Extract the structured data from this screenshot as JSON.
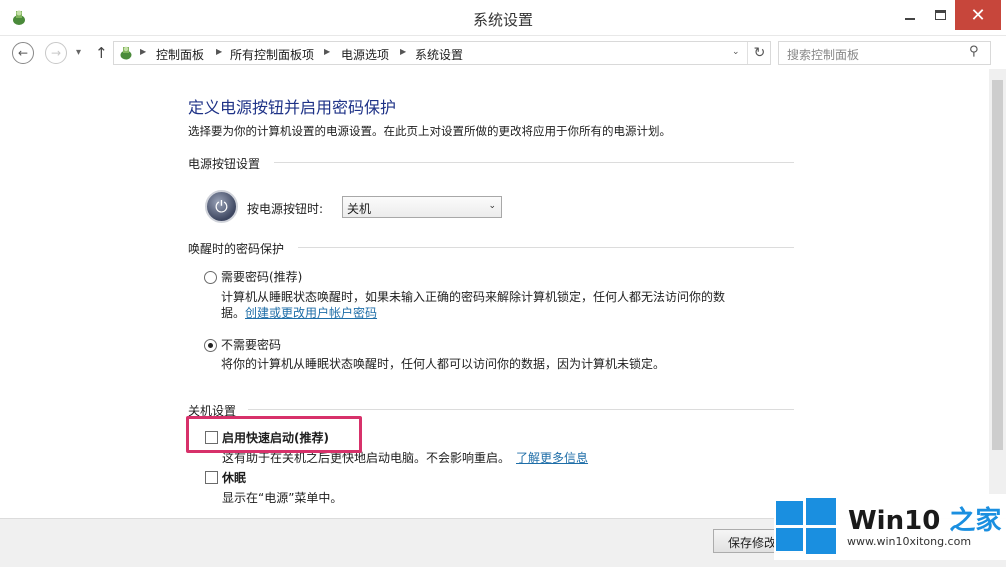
{
  "window": {
    "title": "系统设置",
    "close_glyph": "✕"
  },
  "nav": {
    "back_glyph": "←",
    "forward_glyph": "→",
    "recent_glyph": "▾",
    "up_glyph": "↑",
    "breadcrumbs": [
      "控制面板",
      "所有控制面板项",
      "电源选项",
      "系统设置"
    ],
    "separator_glyph": "▶",
    "dropdown_glyph": "⌄",
    "refresh_glyph": "↻",
    "search_placeholder": "搜索控制面板",
    "search_glyph": "⚲"
  },
  "page": {
    "heading": "定义电源按钮并启用密码保护",
    "description": "选择要为你的计算机设置的电源设置。在此页上对设置所做的更改将应用于你所有的电源计划。"
  },
  "power_button": {
    "section_title": "电源按钮设置",
    "icon_glyph": "⏻",
    "label": "按电源按钮时:",
    "selected": "关机",
    "arrow_glyph": "⌄"
  },
  "wake_password": {
    "section_title": "唤醒时的密码保护",
    "options": [
      {
        "label": "需要密码(推荐)",
        "checked": false,
        "desc_line1": "计算机从睡眠状态唤醒时，如果未输入正确的密码来解除计算机锁定，任何人都无法访问你的数",
        "desc_line2_text": "据。",
        "desc_link": "创建或更改用户帐户密码"
      },
      {
        "label": "不需要密码",
        "checked": true,
        "desc_line1": "将你的计算机从睡眠状态唤醒时，任何人都可以访问你的数据，因为计算机未锁定。"
      }
    ]
  },
  "shutdown": {
    "section_title": "关机设置",
    "fast_startup": {
      "label": "启用快速启动(推荐)",
      "checked": false,
      "desc": "这有助于在关机之后更快地启动电脑。不会影响重启。",
      "link": "了解更多信息"
    },
    "hibernate": {
      "label": "休眠",
      "checked": false,
      "desc": "显示在“电源”菜单中。"
    }
  },
  "footer": {
    "save_label": "保存修改"
  },
  "watermark": {
    "brand_prefix": "Win10",
    "brand_suffix": " 之家",
    "url": "www.win10xitong.com"
  },
  "colors": {
    "heading": "#1e3287",
    "link": "#1f6ea8",
    "highlight_box": "#d7316a",
    "close_button": "#c7463b",
    "win_logo": "#1a8fe0"
  }
}
